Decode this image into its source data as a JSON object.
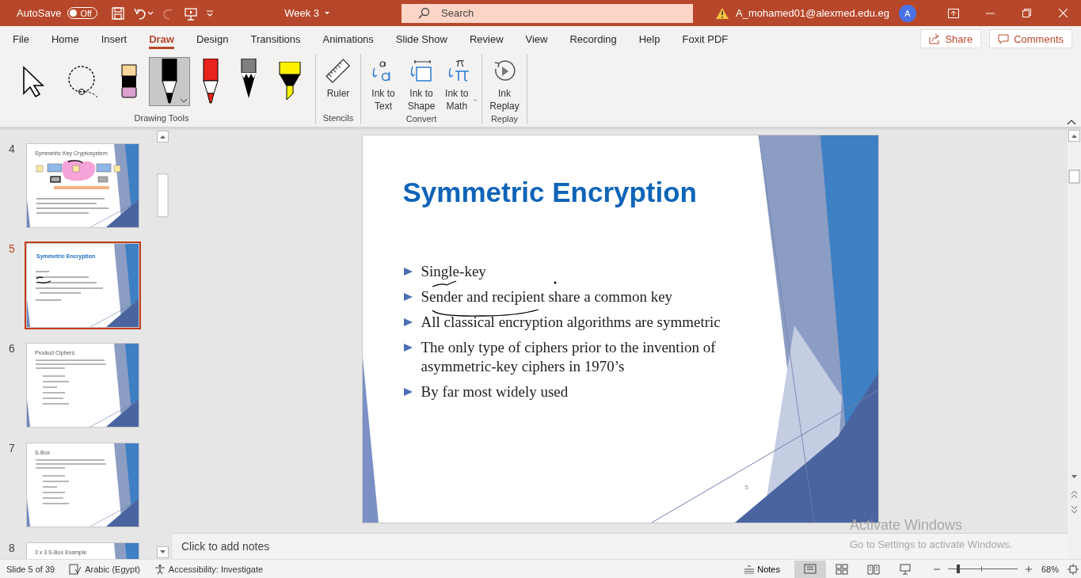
{
  "title_bar": {
    "autosave_label": "AutoSave",
    "autosave": {
      "on": false,
      "label": "Off"
    },
    "quick_access": [
      {
        "kind": "save",
        "disabled": false
      },
      {
        "kind": "undo",
        "disabled": false
      },
      {
        "kind": "redo",
        "disabled": true
      },
      {
        "kind": "present",
        "disabled": false
      }
    ],
    "document_title": "Week 3",
    "search": {
      "placeholder": "Search"
    },
    "account": "A_mohamed01@alexmed.edu.eg",
    "avatar": "A"
  },
  "tabs": [
    {
      "label": "File",
      "selected": false
    },
    {
      "label": "Home",
      "selected": false
    },
    {
      "label": "Insert",
      "selected": false
    },
    {
      "label": "Draw",
      "selected": true
    },
    {
      "label": "Design",
      "selected": false
    },
    {
      "label": "Transitions",
      "selected": false
    },
    {
      "label": "Animations",
      "selected": false
    },
    {
      "label": "Slide Show",
      "selected": false
    },
    {
      "label": "Review",
      "selected": false
    },
    {
      "label": "View",
      "selected": false
    },
    {
      "label": "Recording",
      "selected": false
    },
    {
      "label": "Help",
      "selected": false
    },
    {
      "label": "Foxit PDF",
      "selected": false
    }
  ],
  "share": "Share",
  "comments": "Comments",
  "ribbon": {
    "groups": [
      {
        "label": "Drawing Tools",
        "tools": [
          {
            "kind": "select",
            "selected": false
          },
          {
            "kind": "lasso",
            "selected": false
          },
          {
            "kind": "eraser",
            "selected": false
          },
          {
            "kind": "pen",
            "color": "#000000",
            "selected": true
          },
          {
            "kind": "pen",
            "color": "#e8231c",
            "selected": false
          },
          {
            "kind": "pencil",
            "color": "#7f7f7f",
            "selected": false
          },
          {
            "kind": "highlighter",
            "color": "#fff200",
            "selected": false
          }
        ]
      },
      {
        "label": "Stencils",
        "buttons": [
          {
            "kind": "ruler",
            "label": "Ruler",
            "dropdown": false
          }
        ]
      },
      {
        "label": "Convert",
        "buttons": [
          {
            "kind": "ink-to-text",
            "label": "Ink to Text",
            "dropdown": false
          },
          {
            "kind": "ink-to-shape",
            "label": "Ink to Shape",
            "dropdown": false
          },
          {
            "kind": "ink-to-math",
            "label": "Ink to Math",
            "dropdown": true
          }
        ]
      },
      {
        "label": "Replay",
        "buttons": [
          {
            "kind": "replay",
            "label": "Ink Replay",
            "dropdown": false
          }
        ]
      }
    ]
  },
  "slides": [
    {
      "number": "4",
      "title": "Symmetric Key Cryptosystem",
      "kind": "diagram",
      "selected": false
    },
    {
      "number": "5",
      "title": "Symmetric Encryption",
      "kind": "bullets",
      "selected": true
    },
    {
      "number": "6",
      "title": "Product Ciphers",
      "kind": "list",
      "selected": false
    },
    {
      "number": "7",
      "title": "S-Box",
      "kind": "list",
      "selected": false
    },
    {
      "number": "8",
      "title": "3 x 3 S-Box Example",
      "kind": "cut",
      "selected": false
    }
  ],
  "slide": {
    "title": "Symmetric Encryption",
    "bullets": [
      "Single-key",
      "Sender and recipient share a common key",
      "All classical encryption algorithms are symmetric",
      "The only type of ciphers prior to the invention of asymmetric-key ciphers in 1970’s",
      "By far most widely used"
    ],
    "page_number": "5"
  },
  "notes": {
    "placeholder": "Click to add notes"
  },
  "activation": {
    "title": "Activate Windows",
    "text": "Go to Settings to activate Windows."
  },
  "status_bar": {
    "slide_info": "Slide 5 of 39",
    "language": "Arabic (Egypt)",
    "accessibility": "Accessibility: Investigate",
    "notes": "Notes",
    "views": [
      {
        "kind": "normal",
        "selected": true
      },
      {
        "kind": "sorter",
        "selected": false
      },
      {
        "kind": "reading",
        "selected": false
      },
      {
        "kind": "slideshow",
        "selected": false
      }
    ],
    "zoom": {
      "level": 0.15,
      "reading": "68%"
    }
  }
}
